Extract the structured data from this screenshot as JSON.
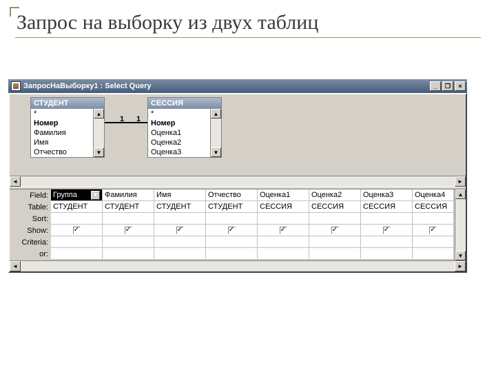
{
  "slide": {
    "title": "Запрос на выборку из двух таблиц"
  },
  "window": {
    "title": "ЗапросНаВыборку1 : Select Query"
  },
  "tables": {
    "t1": {
      "name": "СТУДЕНТ",
      "fields": [
        "*",
        "Номер",
        "Фамилия",
        "Имя",
        "Отчество"
      ]
    },
    "t2": {
      "name": "СЕССИЯ",
      "fields": [
        "*",
        "Номер",
        "Оценка1",
        "Оценка2",
        "Оценка3"
      ]
    },
    "join": {
      "left": "1",
      "right": "1"
    }
  },
  "grid": {
    "rowLabels": {
      "field": "Field:",
      "table": "Table:",
      "sort": "Sort:",
      "show": "Show:",
      "criteria": "Criteria:",
      "or": "or:"
    },
    "cols": [
      {
        "field": "Группа",
        "table": "СТУДЕНТ",
        "show": true,
        "selected": true
      },
      {
        "field": "Фамилия",
        "table": "СТУДЕНТ",
        "show": true
      },
      {
        "field": "Имя",
        "table": "СТУДЕНТ",
        "show": true
      },
      {
        "field": "Отчество",
        "table": "СТУДЕНТ",
        "show": true
      },
      {
        "field": "Оценка1",
        "table": "СЕССИЯ",
        "show": true
      },
      {
        "field": "Оценка2",
        "table": "СЕССИЯ",
        "show": true
      },
      {
        "field": "Оценка3",
        "table": "СЕССИЯ",
        "show": true
      },
      {
        "field": "Оценка4",
        "table": "СЕССИЯ",
        "show": true
      }
    ]
  }
}
